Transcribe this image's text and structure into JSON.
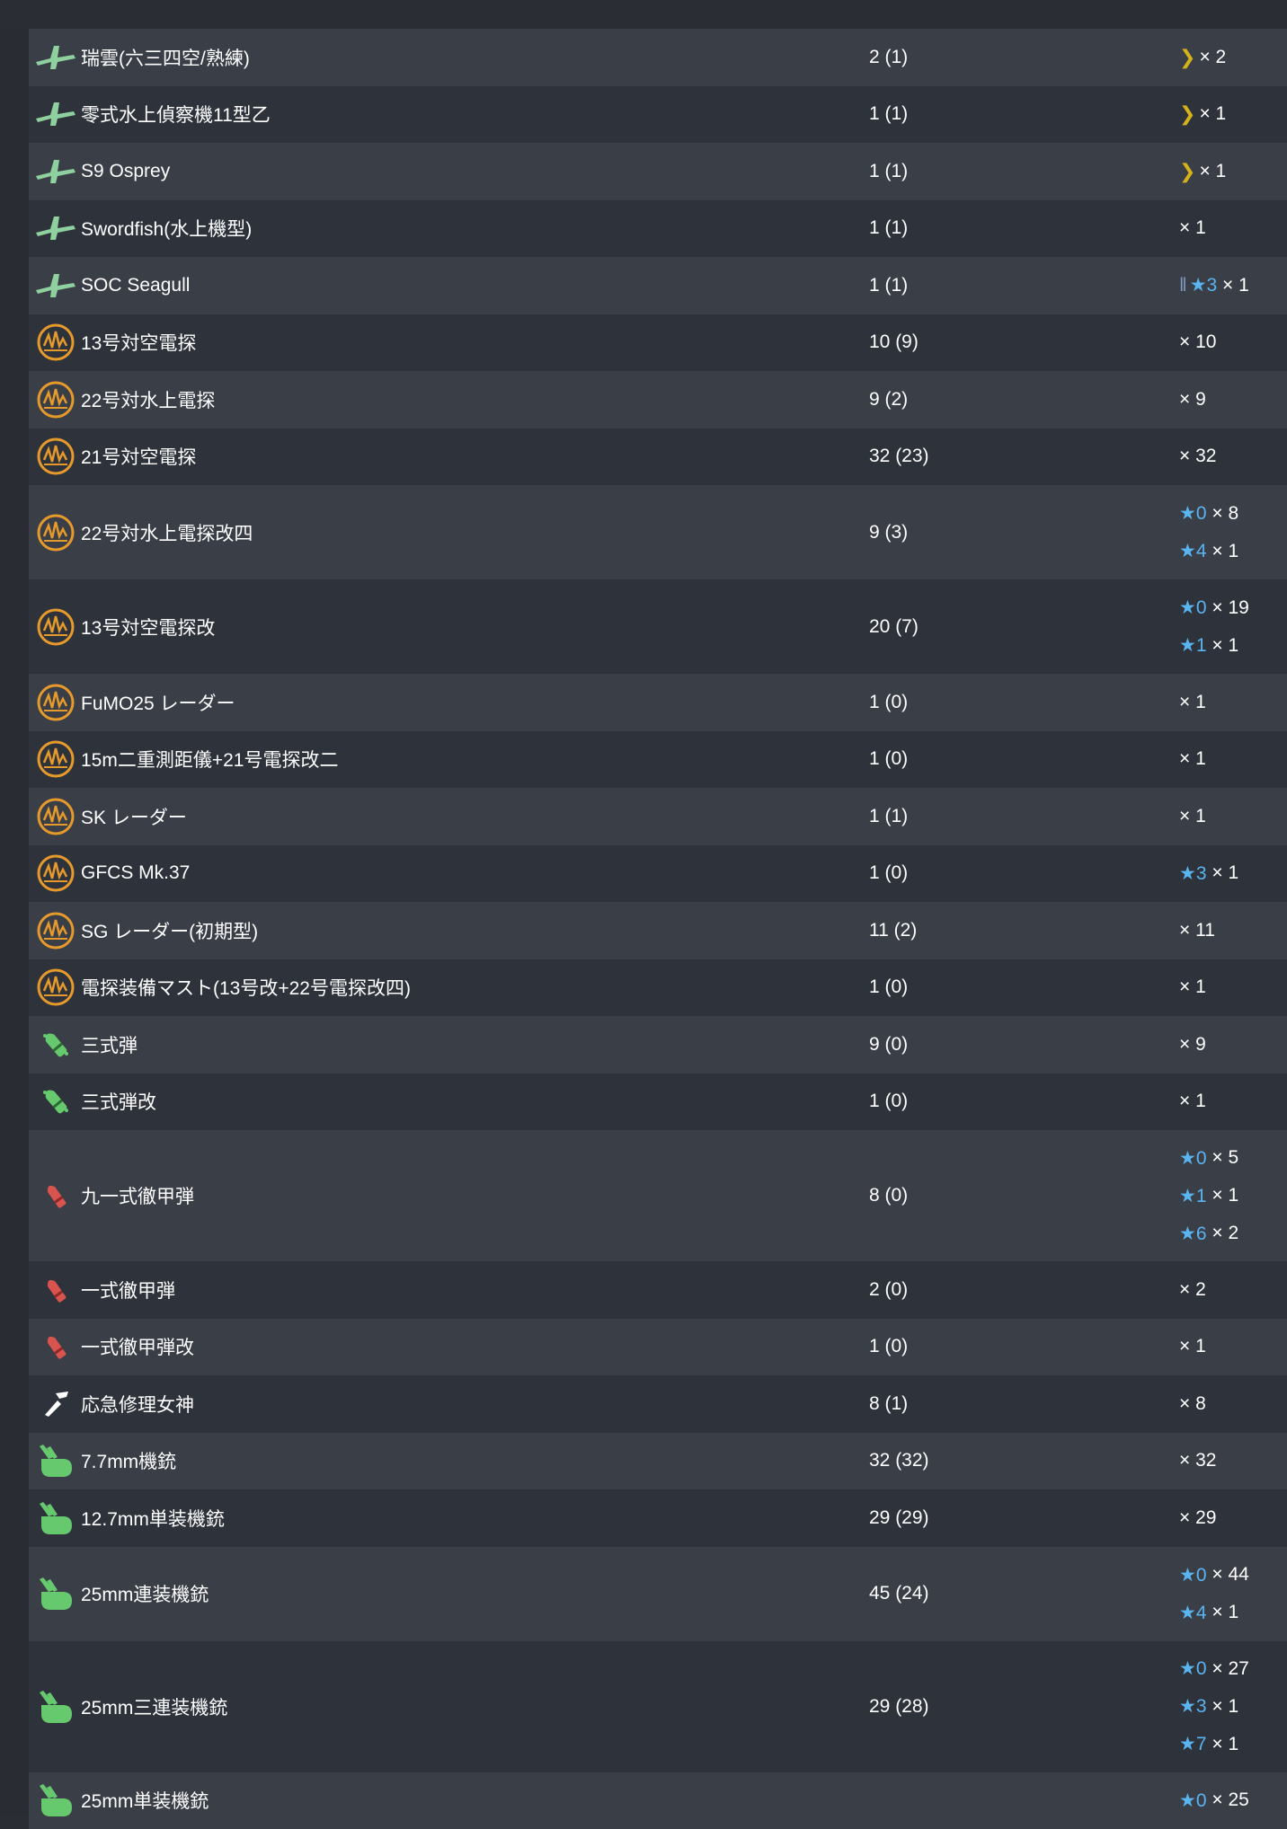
{
  "equipment": [
    {
      "name": "瑞雲(六三四空/熟練)",
      "count": "2 (1)",
      "icon": "seaplane-icon",
      "levels": [
        {
          "type": "chevron",
          "label": "",
          "qty": "× 2"
        }
      ]
    },
    {
      "name": "零式水上偵察機11型乙",
      "count": "1 (1)",
      "icon": "seaplane-icon",
      "levels": [
        {
          "type": "chevron",
          "label": "",
          "qty": "× 1"
        }
      ]
    },
    {
      "name": "S9 Osprey",
      "count": "1 (1)",
      "icon": "seaplane-icon",
      "levels": [
        {
          "type": "chevron",
          "label": "",
          "qty": "× 1"
        }
      ]
    },
    {
      "name": "Swordfish(水上機型)",
      "count": "1 (1)",
      "icon": "seaplane-icon",
      "levels": [
        {
          "type": "plain",
          "label": "",
          "qty": "× 1"
        }
      ]
    },
    {
      "name": "SOC Seagull",
      "count": "1 (1)",
      "icon": "seaplane-icon",
      "levels": [
        {
          "type": "bars-star",
          "label": "★3",
          "qty": "× 1"
        }
      ]
    },
    {
      "name": "13号対空電探",
      "count": "10 (9)",
      "icon": "radar-icon",
      "levels": [
        {
          "type": "plain",
          "label": "",
          "qty": "× 10"
        }
      ]
    },
    {
      "name": "22号対水上電探",
      "count": "9 (2)",
      "icon": "radar-icon",
      "levels": [
        {
          "type": "plain",
          "label": "",
          "qty": "× 9"
        }
      ]
    },
    {
      "name": "21号対空電探",
      "count": "32 (23)",
      "icon": "radar-icon",
      "levels": [
        {
          "type": "plain",
          "label": "",
          "qty": "× 32"
        }
      ]
    },
    {
      "name": "22号対水上電探改四",
      "count": "9 (3)",
      "icon": "radar-icon",
      "levels": [
        {
          "type": "star",
          "label": "★0",
          "qty": "× 8"
        },
        {
          "type": "star",
          "label": "★4",
          "qty": "× 1"
        }
      ]
    },
    {
      "name": "13号対空電探改",
      "count": "20 (7)",
      "icon": "radar-icon",
      "levels": [
        {
          "type": "star",
          "label": "★0",
          "qty": "× 19"
        },
        {
          "type": "star",
          "label": "★1",
          "qty": "× 1"
        }
      ]
    },
    {
      "name": "FuMO25 レーダー",
      "count": "1 (0)",
      "icon": "radar-icon",
      "levels": [
        {
          "type": "plain",
          "label": "",
          "qty": "× 1"
        }
      ]
    },
    {
      "name": "15m二重測距儀+21号電探改二",
      "count": "1 (0)",
      "icon": "radar-icon",
      "levels": [
        {
          "type": "plain",
          "label": "",
          "qty": "× 1"
        }
      ]
    },
    {
      "name": "SK レーダー",
      "count": "1 (1)",
      "icon": "radar-icon",
      "levels": [
        {
          "type": "plain",
          "label": "",
          "qty": "× 1"
        }
      ]
    },
    {
      "name": "GFCS Mk.37",
      "count": "1 (0)",
      "icon": "radar-icon",
      "levels": [
        {
          "type": "star",
          "label": "★3",
          "qty": "× 1"
        }
      ]
    },
    {
      "name": "SG レーダー(初期型)",
      "count": "11 (2)",
      "icon": "radar-icon",
      "levels": [
        {
          "type": "plain",
          "label": "",
          "qty": "× 11"
        }
      ]
    },
    {
      "name": "電探装備マスト(13号改+22号電探改四)",
      "count": "1 (0)",
      "icon": "radar-icon",
      "levels": [
        {
          "type": "plain",
          "label": "",
          "qty": "× 1"
        }
      ]
    },
    {
      "name": "三式弾",
      "count": "9 (0)",
      "icon": "aa-shell-icon",
      "levels": [
        {
          "type": "plain",
          "label": "",
          "qty": "× 9"
        }
      ]
    },
    {
      "name": "三式弾改",
      "count": "1 (0)",
      "icon": "aa-shell-icon",
      "levels": [
        {
          "type": "plain",
          "label": "",
          "qty": "× 1"
        }
      ]
    },
    {
      "name": "九一式徹甲弾",
      "count": "8 (0)",
      "icon": "ap-shell-icon",
      "levels": [
        {
          "type": "star",
          "label": "★0",
          "qty": "× 5"
        },
        {
          "type": "star",
          "label": "★1",
          "qty": "× 1"
        },
        {
          "type": "star",
          "label": "★6",
          "qty": "× 2"
        }
      ]
    },
    {
      "name": "一式徹甲弾",
      "count": "2 (0)",
      "icon": "ap-shell-icon",
      "levels": [
        {
          "type": "plain",
          "label": "",
          "qty": "× 2"
        }
      ]
    },
    {
      "name": "一式徹甲弾改",
      "count": "1 (0)",
      "icon": "ap-shell-icon",
      "levels": [
        {
          "type": "plain",
          "label": "",
          "qty": "× 1"
        }
      ]
    },
    {
      "name": "応急修理女神",
      "count": "8 (1)",
      "icon": "repair-icon",
      "levels": [
        {
          "type": "plain",
          "label": "",
          "qty": "× 8"
        }
      ]
    },
    {
      "name": "7.7mm機銃",
      "count": "32 (32)",
      "icon": "aa-gun-icon",
      "levels": [
        {
          "type": "plain",
          "label": "",
          "qty": "× 32"
        }
      ]
    },
    {
      "name": "12.7mm単装機銃",
      "count": "29 (29)",
      "icon": "aa-gun-icon",
      "levels": [
        {
          "type": "plain",
          "label": "",
          "qty": "× 29"
        }
      ]
    },
    {
      "name": "25mm連装機銃",
      "count": "45 (24)",
      "icon": "aa-gun-icon",
      "levels": [
        {
          "type": "star",
          "label": "★0",
          "qty": "× 44"
        },
        {
          "type": "star",
          "label": "★4",
          "qty": "× 1"
        }
      ]
    },
    {
      "name": "25mm三連装機銃",
      "count": "29 (28)",
      "icon": "aa-gun-icon",
      "levels": [
        {
          "type": "star",
          "label": "★0",
          "qty": "× 27"
        },
        {
          "type": "star",
          "label": "★3",
          "qty": "× 1"
        },
        {
          "type": "star",
          "label": "★7",
          "qty": "× 1"
        }
      ]
    },
    {
      "name": "25mm単装機銃",
      "count": "",
      "icon": "aa-gun-icon",
      "levels": [
        {
          "type": "star",
          "label": "★0",
          "qty": "× 25"
        }
      ]
    }
  ],
  "colors": {
    "star": "#5ab4f0",
    "chevron": "#d4b21c",
    "row_odd": "#3a3e47",
    "row_even": "#2e323a",
    "radar": "#e59a2b",
    "seaplane": "#8fd19e",
    "aa_gun": "#66c96e",
    "ap_shell": "#d9534f"
  }
}
